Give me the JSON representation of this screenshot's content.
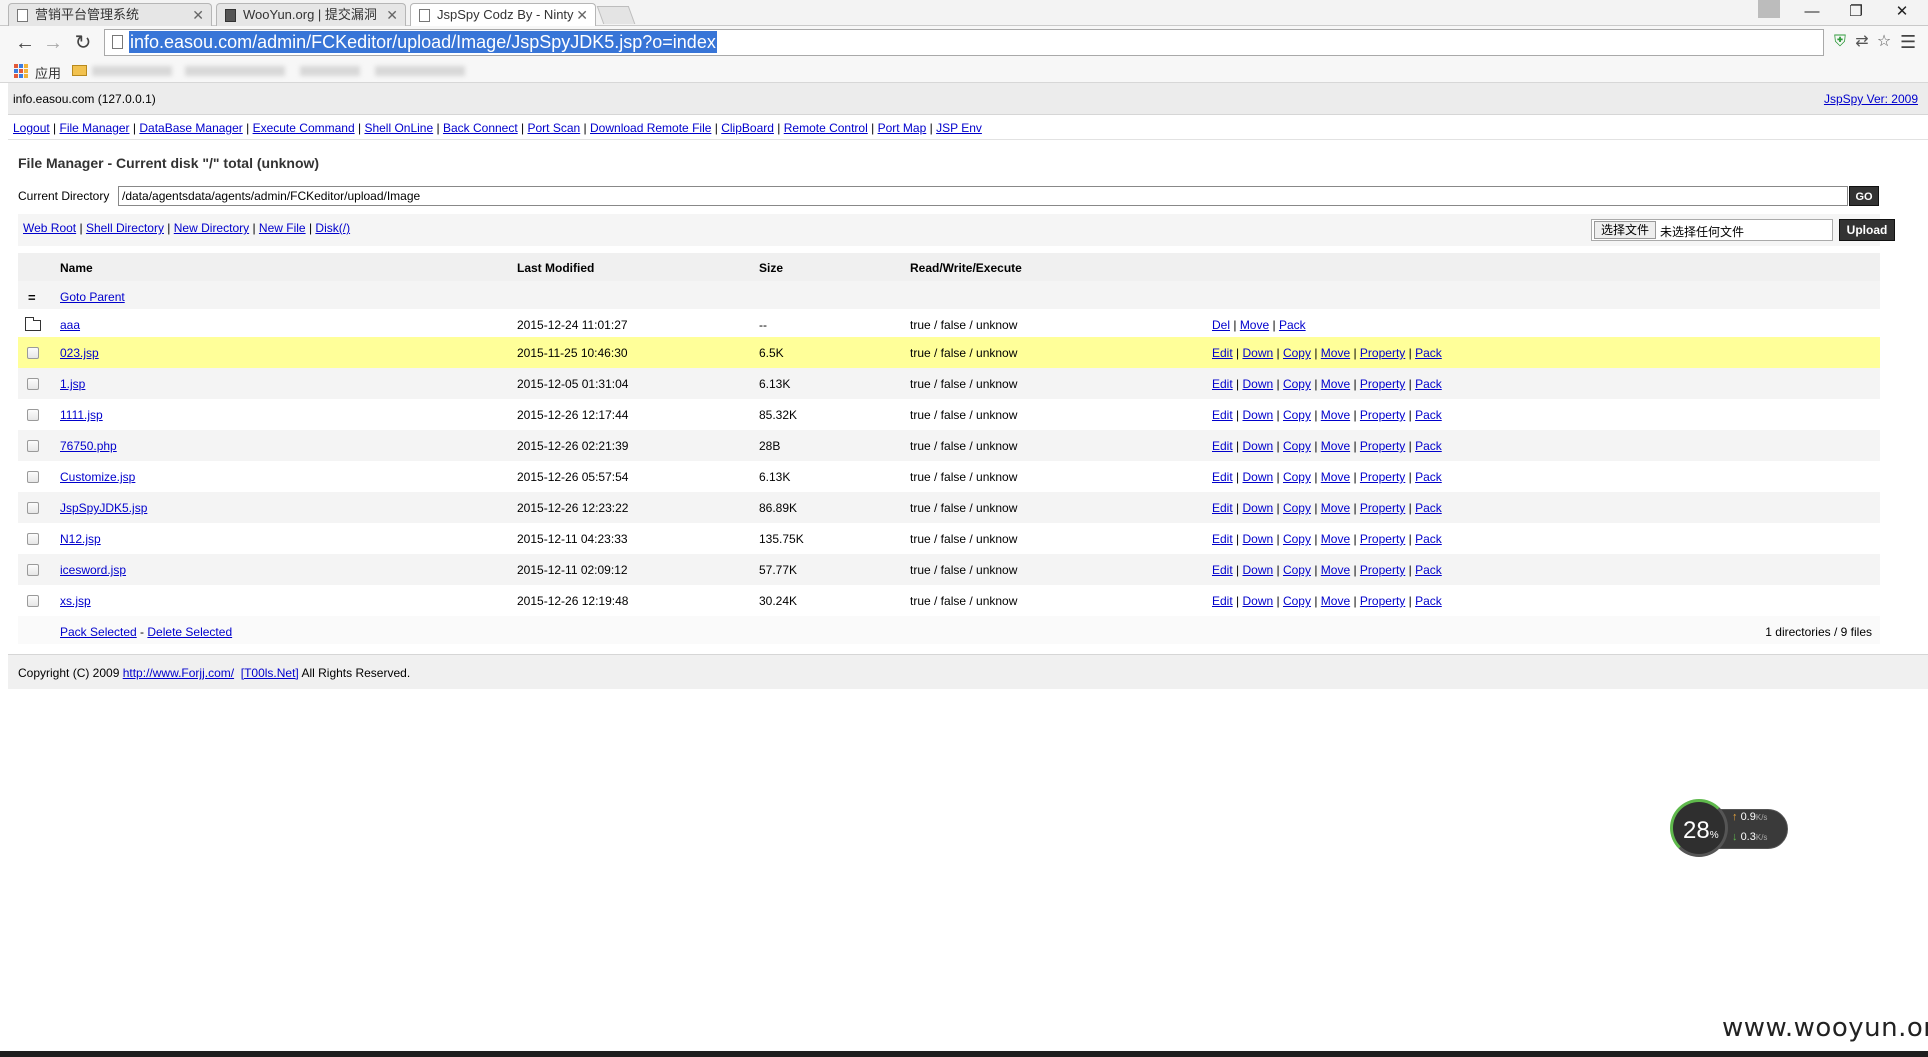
{
  "browser": {
    "tabs": [
      {
        "title": "营销平台管理系统"
      },
      {
        "title": "WooYun.org | 提交漏洞"
      },
      {
        "title": "JspSpy Codz By - Ninty"
      }
    ],
    "url": "info.easou.com/admin/FCKeditor/upload/Image/JspSpyJDK5.jsp?o=index",
    "bookmarks": {
      "apps_label": "应用"
    }
  },
  "header": {
    "host": "info.easou.com (127.0.0.1)",
    "version_link": "JspSpy Ver: 2009"
  },
  "nav": {
    "links": [
      "Logout",
      "File Manager",
      "DataBase Manager",
      "Execute Command",
      "Shell OnLine",
      "Back Connect",
      "Port Scan",
      "Download Remote File",
      "ClipBoard",
      "Remote Control",
      "Port Map",
      "JSP Env"
    ]
  },
  "file_manager": {
    "title": "File Manager - Current disk \"/\" total (unknow)",
    "current_dir_label": "Current Directory",
    "current_dir_value": "/data/agentsdata/agents/admin/FCKeditor/upload/Image",
    "go_label": "GO",
    "action_links": [
      "Web Root",
      "Shell Directory",
      "New Directory",
      "New File",
      "Disk(/)"
    ],
    "choose_file_label": "选择文件",
    "no_file_text": "未选择任何文件",
    "upload_label": "Upload",
    "columns": {
      "name": "Name",
      "modified": "Last Modified",
      "size": "Size",
      "perm": "Read/Write/Execute"
    },
    "parent_icon": "=",
    "parent_link": "Goto Parent",
    "directory": {
      "name": "aaa",
      "modified": "2015-12-24 11:01:27",
      "size": "--",
      "perm": "true / false / unknow",
      "actions": [
        "Del",
        "Move",
        "Pack"
      ]
    },
    "file_actions": [
      "Edit",
      "Down",
      "Copy",
      "Move",
      "Property",
      "Pack"
    ],
    "files": [
      {
        "name": "023.jsp",
        "modified": "2015-11-25 10:46:30",
        "size": "6.5K",
        "perm": "true / false / unknow"
      },
      {
        "name": "1.jsp",
        "modified": "2015-12-05 01:31:04",
        "size": "6.13K",
        "perm": "true / false / unknow"
      },
      {
        "name": "1111.jsp",
        "modified": "2015-12-26 12:17:44",
        "size": "85.32K",
        "perm": "true / false / unknow"
      },
      {
        "name": "76750.php",
        "modified": "2015-12-26 02:21:39",
        "size": "28B",
        "perm": "true / false / unknow"
      },
      {
        "name": "Customize.jsp",
        "modified": "2015-12-26 05:57:54",
        "size": "6.13K",
        "perm": "true / false / unknow"
      },
      {
        "name": "JspSpyJDK5.jsp",
        "modified": "2015-12-26 12:23:22",
        "size": "86.89K",
        "perm": "true / false / unknow"
      },
      {
        "name": "N12.jsp",
        "modified": "2015-12-11 04:23:33",
        "size": "135.75K",
        "perm": "true / false / unknow"
      },
      {
        "name": "icesword.jsp",
        "modified": "2015-12-11 02:09:12",
        "size": "57.77K",
        "perm": "true / false / unknow"
      },
      {
        "name": "xs.jsp",
        "modified": "2015-12-26 12:19:48",
        "size": "30.24K",
        "perm": "true / false / unknow"
      }
    ],
    "pack_selected": "Pack Selected",
    "delete_selected": "Delete Selected",
    "bulk_separator": " - ",
    "summary": "1 directories / 9 files"
  },
  "footer": {
    "prefix": "Copyright (C) 2009 ",
    "link1": "http://www.Forjj.com/",
    "link2": "[T00ls.Net]",
    "suffix": " All Rights Reserved."
  },
  "net_widget": {
    "percent": "28",
    "percent_unit": "%",
    "up": "0.9",
    "down": "0.3",
    "unit": "K/s"
  },
  "watermark": "www.wooyun.org",
  "colors": {
    "highlight_row": "#ffff99",
    "link": "#0000cc",
    "selection": "#3875d7"
  }
}
